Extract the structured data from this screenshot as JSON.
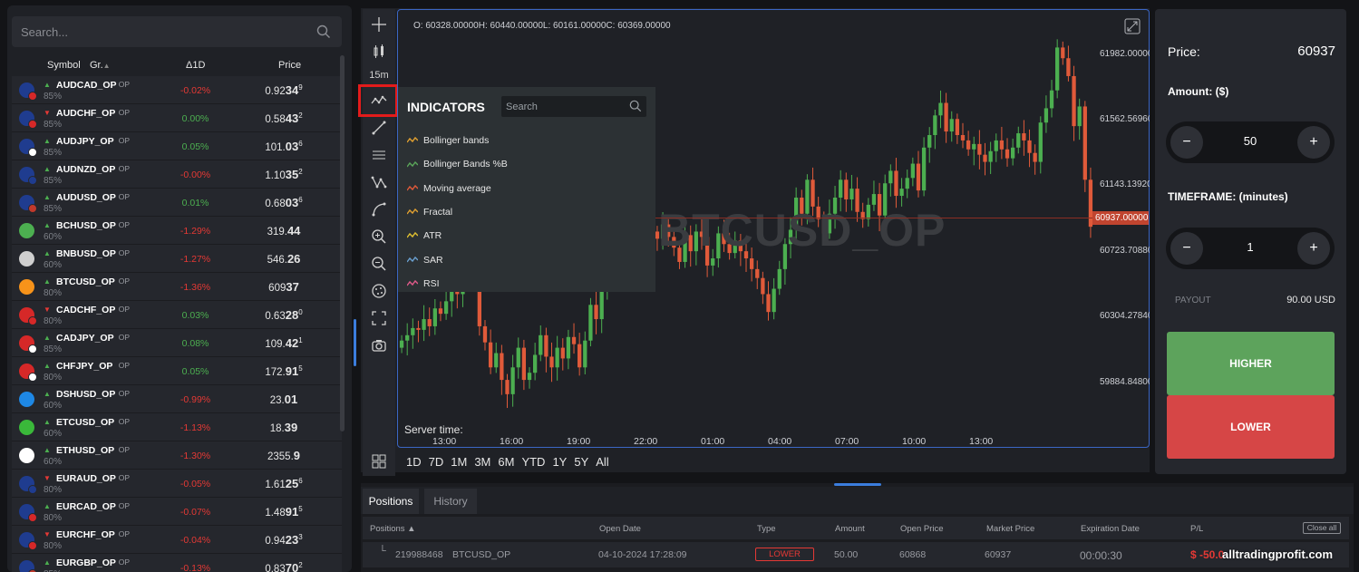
{
  "left_panel": {
    "search_placeholder": "Search...",
    "headers": {
      "symbol": "Symbol",
      "group": "Gr.",
      "delta": "Δ1D",
      "price": "Price"
    },
    "instruments": [
      {
        "symbol": "AUDCAD_OP",
        "tag": "OP",
        "payout": "85%",
        "dir": "up",
        "change": "-0.02%",
        "change_dir": "down",
        "price_a": "0.92",
        "price_b": "34",
        "price_c": "9",
        "flag1": "#1f3c8f",
        "flag2": "#d62828"
      },
      {
        "symbol": "AUDCHF_OP",
        "tag": "OP",
        "payout": "85%",
        "dir": "down",
        "change": "0.00%",
        "change_dir": "up",
        "price_a": "0.58",
        "price_b": "43",
        "price_c": "2",
        "flag1": "#1f3c8f",
        "flag2": "#d62828"
      },
      {
        "symbol": "AUDJPY_OP",
        "tag": "OP",
        "payout": "85%",
        "dir": "up",
        "change": "0.05%",
        "change_dir": "up",
        "price_a": "101.",
        "price_b": "03",
        "price_c": "6",
        "flag1": "#1f3c8f",
        "flag2": "#ffffff"
      },
      {
        "symbol": "AUDNZD_OP",
        "tag": "OP",
        "payout": "85%",
        "dir": "up",
        "change": "-0.00%",
        "change_dir": "down",
        "price_a": "1.10",
        "price_b": "35",
        "price_c": "2",
        "flag1": "#1f3c8f",
        "flag2": "#1f3c8f"
      },
      {
        "symbol": "AUDUSD_OP",
        "tag": "OP",
        "payout": "85%",
        "dir": "up",
        "change": "0.01%",
        "change_dir": "up",
        "price_a": "0.68",
        "price_b": "03",
        "price_c": "6",
        "flag1": "#1f3c8f",
        "flag2": "#c0392b"
      },
      {
        "symbol": "BCHUSD_OP",
        "tag": "OP",
        "payout": "60%",
        "dir": "up",
        "change": "-1.29%",
        "change_dir": "down",
        "price_a": "319.",
        "price_b": "44",
        "price_c": "",
        "flag1": "#4caf50",
        "flag2": ""
      },
      {
        "symbol": "BNBUSD_OP",
        "tag": "OP",
        "payout": "60%",
        "dir": "up",
        "change": "-1.27%",
        "change_dir": "down",
        "price_a": "546.",
        "price_b": "26",
        "price_c": "",
        "flag1": "#cfcfcf",
        "flag2": ""
      },
      {
        "symbol": "BTCUSD_OP",
        "tag": "OP",
        "payout": "80%",
        "dir": "up",
        "change": "-1.36%",
        "change_dir": "down",
        "price_a": "609",
        "price_b": "37",
        "price_c": "",
        "flag1": "#f7931a",
        "flag2": ""
      },
      {
        "symbol": "CADCHF_OP",
        "tag": "OP",
        "payout": "80%",
        "dir": "down",
        "change": "0.03%",
        "change_dir": "up",
        "price_a": "0.63",
        "price_b": "28",
        "price_c": "0",
        "flag1": "#d62828",
        "flag2": "#d62828"
      },
      {
        "symbol": "CADJPY_OP",
        "tag": "OP",
        "payout": "85%",
        "dir": "up",
        "change": "0.08%",
        "change_dir": "up",
        "price_a": "109.",
        "price_b": "42",
        "price_c": "1",
        "flag1": "#d62828",
        "flag2": "#ffffff"
      },
      {
        "symbol": "CHFJPY_OP",
        "tag": "OP",
        "payout": "80%",
        "dir": "up",
        "change": "0.05%",
        "change_dir": "up",
        "price_a": "172.",
        "price_b": "91",
        "price_c": "5",
        "flag1": "#d62828",
        "flag2": "#ffffff"
      },
      {
        "symbol": "DSHUSD_OP",
        "tag": "OP",
        "payout": "60%",
        "dir": "up",
        "change": "-0.99%",
        "change_dir": "down",
        "price_a": "23.",
        "price_b": "01",
        "price_c": "",
        "flag1": "#1e88e5",
        "flag2": ""
      },
      {
        "symbol": "ETCUSD_OP",
        "tag": "OP",
        "payout": "60%",
        "dir": "up",
        "change": "-1.13%",
        "change_dir": "down",
        "price_a": "18.",
        "price_b": "39",
        "price_c": "",
        "flag1": "#3ab83a",
        "flag2": ""
      },
      {
        "symbol": "ETHUSD_OP",
        "tag": "OP",
        "payout": "60%",
        "dir": "up",
        "change": "-1.30%",
        "change_dir": "down",
        "price_a": "2355.",
        "price_b": "9",
        "price_c": "",
        "flag1": "#ffffff",
        "flag2": ""
      },
      {
        "symbol": "EURAUD_OP",
        "tag": "OP",
        "payout": "80%",
        "dir": "down",
        "change": "-0.05%",
        "change_dir": "down",
        "price_a": "1.61",
        "price_b": "25",
        "price_c": "6",
        "flag1": "#1f3c8f",
        "flag2": "#1f3c8f"
      },
      {
        "symbol": "EURCAD_OP",
        "tag": "OP",
        "payout": "80%",
        "dir": "up",
        "change": "-0.07%",
        "change_dir": "down",
        "price_a": "1.48",
        "price_b": "91",
        "price_c": "5",
        "flag1": "#1f3c8f",
        "flag2": "#d62828"
      },
      {
        "symbol": "EURCHF_OP",
        "tag": "OP",
        "payout": "80%",
        "dir": "down",
        "change": "-0.04%",
        "change_dir": "down",
        "price_a": "0.94",
        "price_b": "23",
        "price_c": "3",
        "flag1": "#1f3c8f",
        "flag2": "#d62828"
      },
      {
        "symbol": "EURGBP_OP",
        "tag": "OP",
        "payout": "85%",
        "dir": "up",
        "change": "-0.13%",
        "change_dir": "down",
        "price_a": "0.83",
        "price_b": "70",
        "price_c": "2",
        "flag1": "#1f3c8f",
        "flag2": "#c0392b"
      }
    ]
  },
  "toolbar": {
    "timeframe": "15m",
    "tools": [
      "crosshair-icon",
      "candles-icon",
      "indicators-icon",
      "trendline-icon",
      "hlines-icon",
      "pattern-icon",
      "curve-icon",
      "zoom-in-icon",
      "zoom-out-icon",
      "cookie-icon",
      "fullscreen-icon",
      "camera-icon",
      "layout-icon"
    ]
  },
  "chart": {
    "ohlc": "O: 60328.00000H: 60440.00000L: 60161.00000C: 60369.00000",
    "watermark": "BTCUSD_OP",
    "server_time": "Server time:",
    "current_price": "60937.00000",
    "price_ticks": [
      "61982.00000",
      "61562.56960",
      "61143.13920",
      "60723.70880",
      "60304.27840",
      "59884.84800"
    ],
    "time_ticks": [
      "13:00",
      "16:00",
      "19:00",
      "22:00",
      "01:00",
      "04:00",
      "07:00",
      "10:00",
      "13:00"
    ],
    "periods": [
      "1D",
      "7D",
      "1M",
      "3M",
      "6M",
      "YTD",
      "1Y",
      "5Y",
      "All"
    ]
  },
  "indicators": {
    "title": "INDICATORS",
    "search_placeholder": "Search",
    "items": [
      {
        "label": "Bollinger bands",
        "color": "#e0a030"
      },
      {
        "label": "Bollinger Bands %B",
        "color": "#5aa55a"
      },
      {
        "label": "Moving average",
        "color": "#e05a3a"
      },
      {
        "label": "Fractal",
        "color": "#e0a030"
      },
      {
        "label": "ATR",
        "color": "#e0c030"
      },
      {
        "label": "SAR",
        "color": "#6aa0d0"
      },
      {
        "label": "RSI",
        "color": "#e05a8a"
      }
    ]
  },
  "chart_data": {
    "type": "candlestick",
    "title": "BTCUSD_OP",
    "xlabel": "",
    "ylabel": "",
    "ylim": [
      59700,
      62150
    ],
    "x_ticks": [
      "13:00",
      "16:00",
      "19:00",
      "22:00",
      "01:00",
      "04:00",
      "07:00",
      "10:00",
      "13:00"
    ],
    "candles_close": [
      60300,
      60330,
      60370,
      60360,
      60420,
      60380,
      60480,
      60450,
      60520,
      60600,
      60560,
      60640,
      60720,
      60680,
      60380,
      60290,
      60150,
      60230,
      60080,
      60000,
      60150,
      60260,
      60080,
      60120,
      60220,
      60330,
      60210,
      60150,
      60260,
      60200,
      60320,
      60280,
      60150,
      60300,
      60500,
      60420,
      60600,
      60880,
      60960,
      60850,
      60780,
      60900,
      61000,
      60960,
      60820,
      60910,
      60870,
      60950,
      60880,
      60820,
      60740,
      60890,
      60800,
      60910,
      60880,
      60720,
      60760,
      60900,
      60840,
      60790,
      60860,
      60800,
      60760,
      60700,
      60650,
      60560,
      60460,
      60590,
      60700,
      60840,
      60920,
      61100,
      61010,
      61200,
      61050,
      60980,
      60900,
      61010,
      61100,
      61200,
      61090,
      61150,
      61020,
      60980,
      61060,
      61120,
      61000,
      61180,
      61250,
      61110,
      61150,
      61210,
      61290,
      61140,
      61380,
      61450,
      61560,
      61630,
      61470,
      61540,
      61450,
      61420,
      61370,
      61400,
      61340,
      61300,
      61360,
      61420,
      61370,
      61320,
      61380,
      61460,
      61420,
      61350,
      61300,
      61520,
      61600,
      61700,
      61940,
      61880,
      61780,
      61500,
      61610,
      61200,
      60937
    ],
    "current_price": 60937
  },
  "bottom": {
    "tabs": [
      "Positions",
      "History"
    ],
    "headers": [
      "Positions ▲",
      "Open Date",
      "Type",
      "Amount",
      "Open Price",
      "Market Price",
      "Expiration Date",
      "P/L"
    ],
    "close_all": "Close all",
    "row": {
      "id": "219988468",
      "symbol": "BTCUSD_OP",
      "open_date": "04-10-2024 17:28:09",
      "type": "LOWER",
      "amount": "50.00",
      "open_price": "60868",
      "market_price": "60937",
      "expiration": "00:00:30",
      "pl": "$ -50.0"
    },
    "site_watermark": "alltradingprofit.com"
  },
  "trade_panel": {
    "price_label": "Price:",
    "price_value": "60937",
    "amount_label": "Amount: ($)",
    "amount_value": "50",
    "minus": "−",
    "plus": "+",
    "timeframe_label": "TIMEFRAME: (minutes)",
    "timeframe_value": "1",
    "payout_label": "PAYOUT",
    "payout_value": "90.00 USD",
    "higher": "HIGHER",
    "lower": "LOWER",
    "colors": {
      "higher": "#5da35c",
      "lower": "#d64646",
      "accent": "#3b7ddd"
    }
  }
}
